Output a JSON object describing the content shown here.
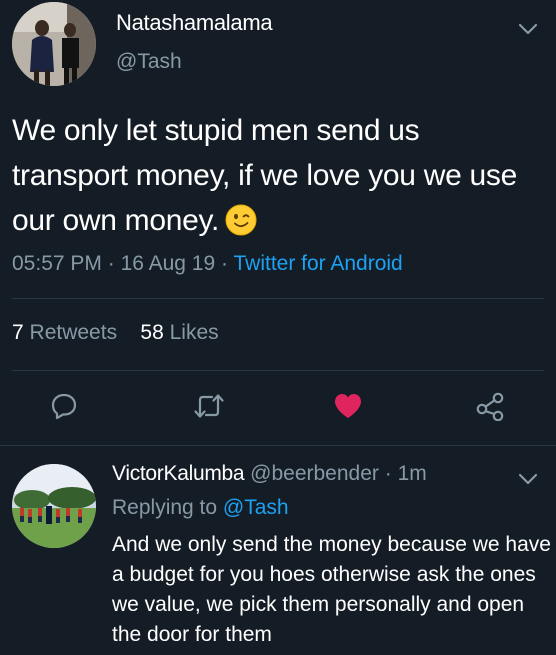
{
  "tweet": {
    "display_name": "Natashamalama",
    "handle": "@Tash",
    "text": "We only let stupid men send us transport money, if we love you we use our own money.",
    "emoji": "winking-face",
    "time": "05:57 PM",
    "date": "16 Aug 19",
    "separator": "·",
    "source": "Twitter for Android",
    "retweets_count": "7",
    "retweets_label": "Retweets",
    "likes_count": "58",
    "likes_label": "Likes",
    "liked": true,
    "colors": {
      "background": "#141d26",
      "muted": "#8899a6",
      "link": "#1da1f2",
      "heart": "#e0245e"
    }
  },
  "reply": {
    "display_name": "VictorKalumba",
    "handle": "@beerbender",
    "separator": "·",
    "time": "1m",
    "replying_label": "Replying to",
    "replying_to": "@Tash",
    "text": "And we only send the money because we have a budget for you hoes otherwise ask the ones we value, we pick them personally and open the door for them"
  },
  "icons": [
    "chevron-down-icon",
    "reply-icon",
    "retweet-icon",
    "heart-icon",
    "share-icon"
  ]
}
